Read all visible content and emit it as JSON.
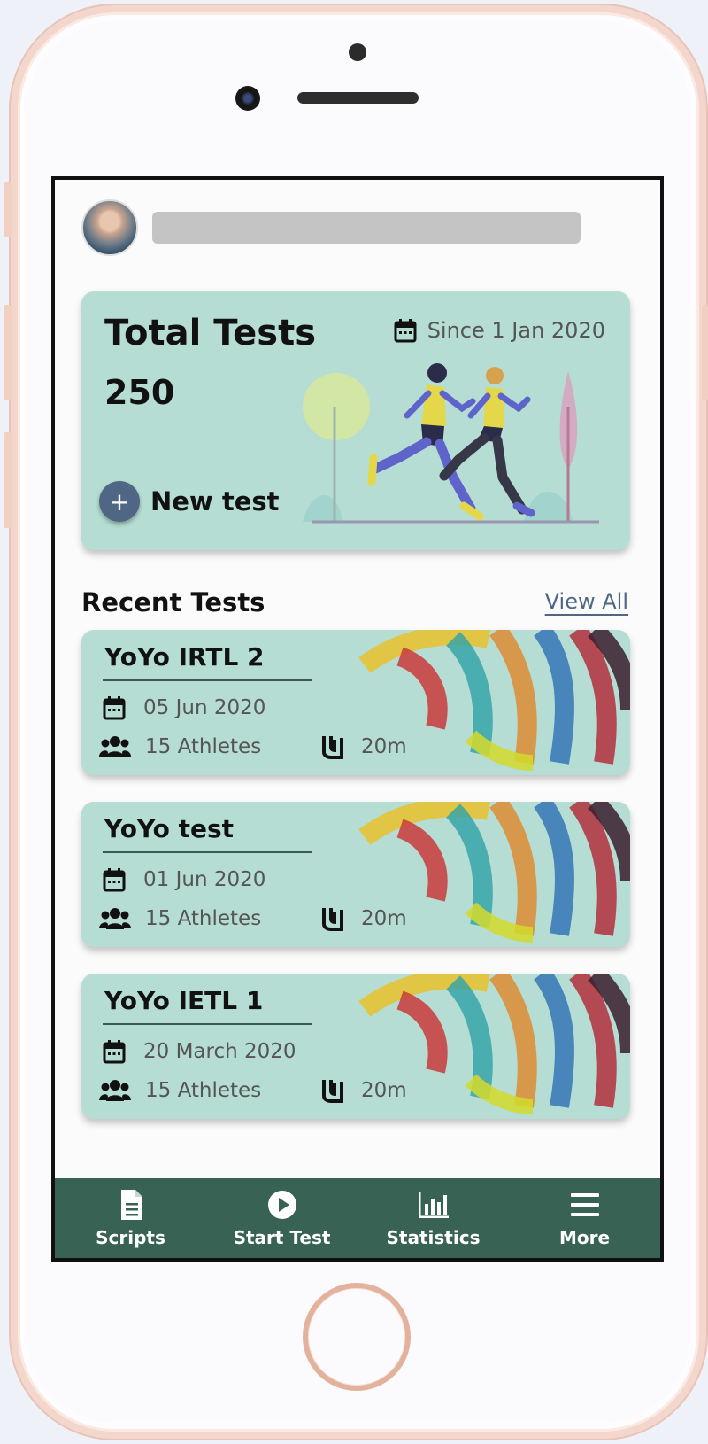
{
  "total_card": {
    "title": "Total Tests",
    "count": "250",
    "since": "Since 1 Jan 2020",
    "new_test_label": "New test",
    "plus_symbol": "+"
  },
  "recent": {
    "heading": "Recent Tests",
    "view_all": "View All",
    "tests": [
      {
        "name": "YoYo IRTL 2",
        "date": "05 Jun 2020",
        "athletes": "15 Athletes",
        "distance": "20m"
      },
      {
        "name": "YoYo test",
        "date": "01 Jun 2020",
        "athletes": "15 Athletes",
        "distance": "20m"
      },
      {
        "name": "YoYo IETL 1",
        "date": "20 March 2020",
        "athletes": "15 Athletes",
        "distance": "20m"
      }
    ]
  },
  "tabbar": {
    "items": [
      {
        "label": "Scripts",
        "icon": "document-icon"
      },
      {
        "label": "Start Test",
        "icon": "play-icon"
      },
      {
        "label": "Statistics",
        "icon": "bar-chart-icon"
      },
      {
        "label": "More",
        "icon": "menu-icon"
      }
    ]
  },
  "colors": {
    "card_bg": "#b5ddd3",
    "tabbar_bg": "#386253",
    "accent": "#4f6784"
  }
}
